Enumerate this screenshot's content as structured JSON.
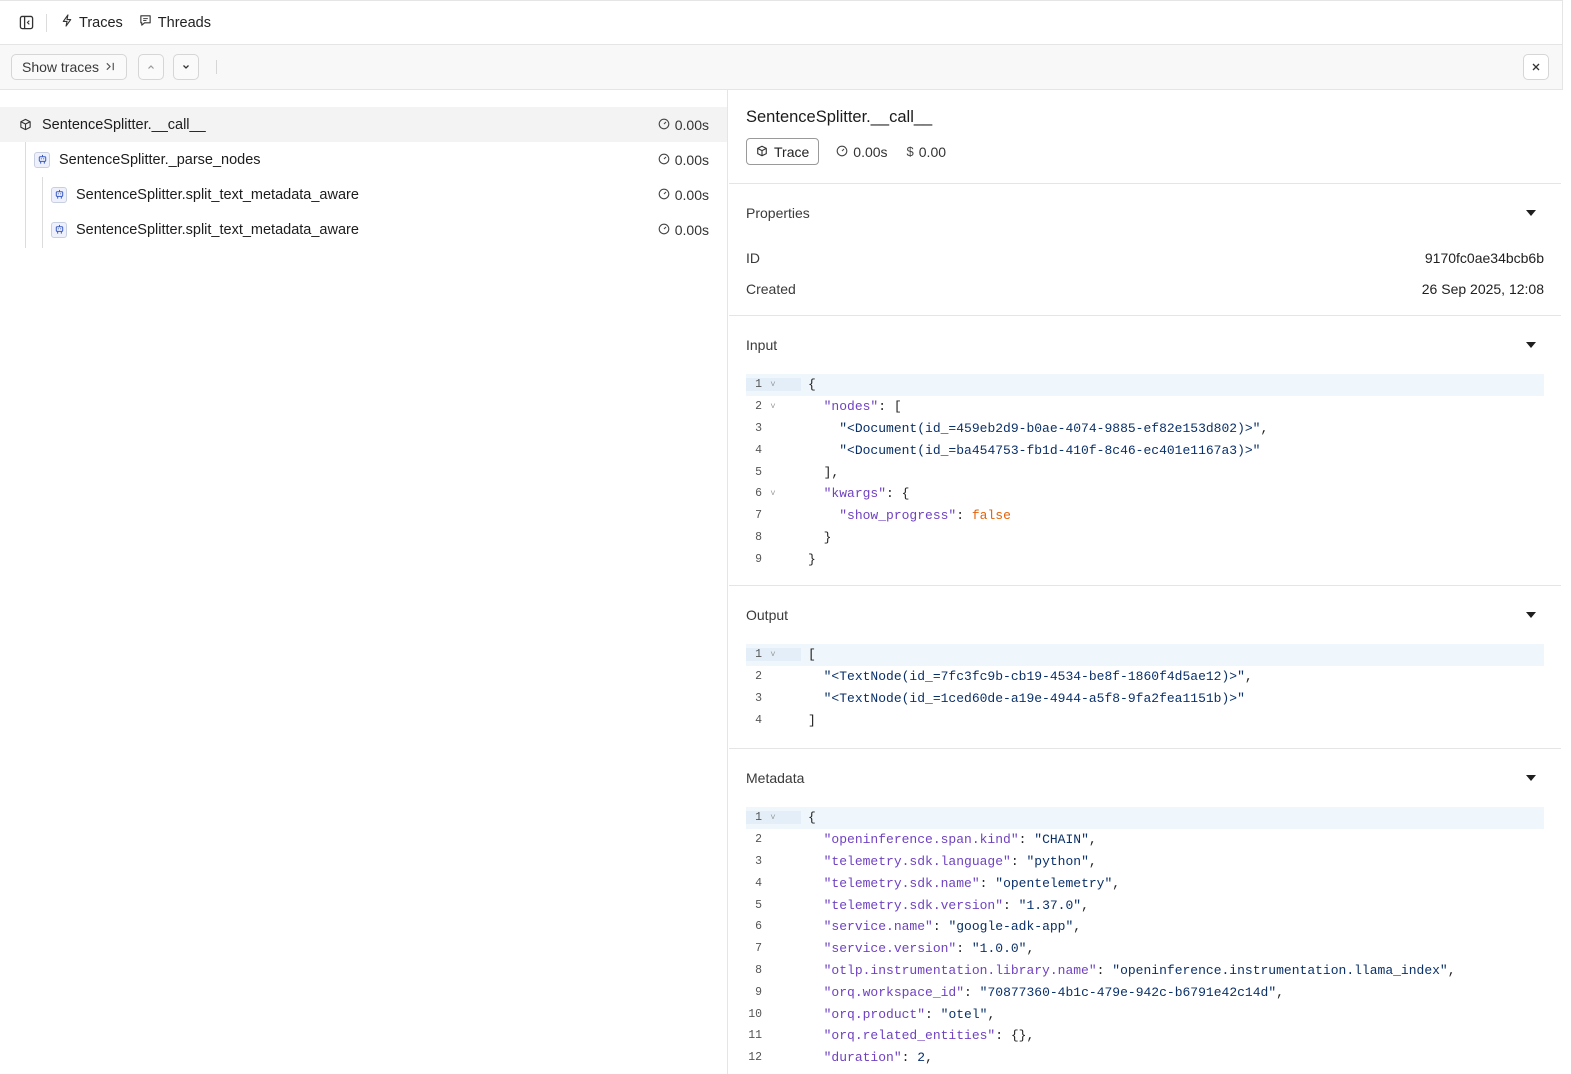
{
  "nav": {
    "tabs": [
      {
        "label": "Traces",
        "icon": "lightning-icon"
      },
      {
        "label": "Threads",
        "icon": "chat-icon"
      }
    ]
  },
  "toolbar": {
    "show_traces_label": "Show traces"
  },
  "tree": {
    "rows": [
      {
        "label": "SentenceSplitter.__call__",
        "time": "0.00s",
        "icon": "cube-icon",
        "depth": 0,
        "selected": true
      },
      {
        "label": "SentenceSplitter._parse_nodes",
        "time": "0.00s",
        "icon": "robot-icon",
        "depth": 1,
        "selected": false
      },
      {
        "label": "SentenceSplitter.split_text_metadata_aware",
        "time": "0.00s",
        "icon": "robot-icon",
        "depth": 2,
        "selected": false
      },
      {
        "label": "SentenceSplitter.split_text_metadata_aware",
        "time": "0.00s",
        "icon": "robot-icon",
        "depth": 2,
        "selected": false
      }
    ]
  },
  "detail": {
    "title": "SentenceSplitter.__call__",
    "badge": "Trace",
    "duration": "0.00s",
    "cost": "0.00",
    "properties": {
      "title": "Properties",
      "rows": [
        {
          "key": "ID",
          "value": "9170fc0ae34bcb6b"
        },
        {
          "key": "Created",
          "value": "26 Sep 2025, 12:08"
        }
      ]
    },
    "input": {
      "title": "Input",
      "lines": [
        {
          "n": "1",
          "fold": true,
          "text": "{"
        },
        {
          "n": "2",
          "fold": true,
          "text": "  \"nodes\": ["
        },
        {
          "n": "3",
          "fold": false,
          "text": "    \"<Document(id_=459eb2d9-b0ae-4074-9885-ef82e153d802)>\","
        },
        {
          "n": "4",
          "fold": false,
          "text": "    \"<Document(id_=ba454753-fb1d-410f-8c46-ec401e1167a3)>\""
        },
        {
          "n": "5",
          "fold": false,
          "text": "  ],"
        },
        {
          "n": "6",
          "fold": true,
          "text": "  \"kwargs\": {"
        },
        {
          "n": "7",
          "fold": false,
          "text": "    \"show_progress\": false"
        },
        {
          "n": "8",
          "fold": false,
          "text": "  }"
        },
        {
          "n": "9",
          "fold": false,
          "text": "}"
        }
      ]
    },
    "output": {
      "title": "Output",
      "lines": [
        {
          "n": "1",
          "fold": true,
          "text": "["
        },
        {
          "n": "2",
          "fold": false,
          "text": "  \"<TextNode(id_=7fc3fc9b-cb19-4534-be8f-1860f4d5ae12)>\","
        },
        {
          "n": "3",
          "fold": false,
          "text": "  \"<TextNode(id_=1ced60de-a19e-4944-a5f8-9fa2fea1151b)>\""
        },
        {
          "n": "4",
          "fold": false,
          "text": "]"
        }
      ]
    },
    "metadata": {
      "title": "Metadata",
      "lines": [
        {
          "n": "1",
          "fold": true,
          "text": "{"
        },
        {
          "n": "2",
          "fold": false,
          "text": "  \"openinference.span.kind\": \"CHAIN\","
        },
        {
          "n": "3",
          "fold": false,
          "text": "  \"telemetry.sdk.language\": \"python\","
        },
        {
          "n": "4",
          "fold": false,
          "text": "  \"telemetry.sdk.name\": \"opentelemetry\","
        },
        {
          "n": "5",
          "fold": false,
          "text": "  \"telemetry.sdk.version\": \"1.37.0\","
        },
        {
          "n": "6",
          "fold": false,
          "text": "  \"service.name\": \"google-adk-app\","
        },
        {
          "n": "7",
          "fold": false,
          "text": "  \"service.version\": \"1.0.0\","
        },
        {
          "n": "8",
          "fold": false,
          "text": "  \"otlp.instrumentation.library.name\": \"openinference.instrumentation.llama_index\","
        },
        {
          "n": "9",
          "fold": false,
          "text": "  \"orq.workspace_id\": \"70877360-4b1c-479e-942c-b6791e42c14d\","
        },
        {
          "n": "10",
          "fold": false,
          "text": "  \"orq.product\": \"otel\","
        },
        {
          "n": "11",
          "fold": false,
          "text": "  \"orq.related_entities\": {},"
        },
        {
          "n": "12",
          "fold": false,
          "text": "  \"duration\": 2,"
        }
      ]
    }
  }
}
